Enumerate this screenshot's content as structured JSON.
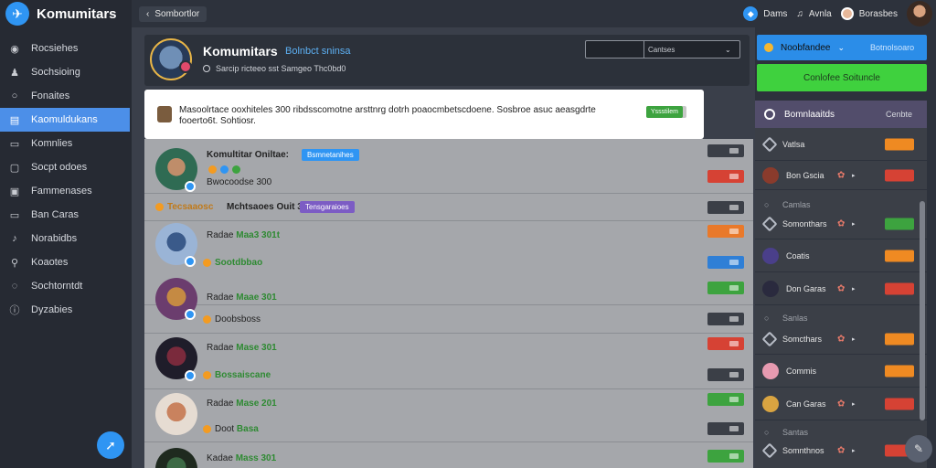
{
  "app": {
    "name": "Komumitars"
  },
  "sidebar": {
    "items": [
      {
        "label": "Rocsiehes",
        "icon": "globe-icon"
      },
      {
        "label": "Sochsioing",
        "icon": "users-icon"
      },
      {
        "label": "Fonaites",
        "icon": "search-icon"
      },
      {
        "label": "Kaomuldukans",
        "icon": "list-icon",
        "active": true
      },
      {
        "label": "Komnlies",
        "icon": "folder-icon"
      },
      {
        "label": "Socpt odoes",
        "icon": "clipboard-icon"
      },
      {
        "label": "Fammenases",
        "icon": "calendar-icon"
      },
      {
        "label": "Ban Caras",
        "icon": "card-icon"
      },
      {
        "label": "Norabidbs",
        "icon": "bell-icon"
      },
      {
        "label": "Koaotes",
        "icon": "share-icon"
      },
      {
        "label": "Sochtorntdt",
        "icon": "chat-icon"
      },
      {
        "label": "Dyzabies",
        "icon": "info-icon"
      }
    ]
  },
  "topbar": {
    "back_label": "Sombortlor",
    "items": [
      "Dams",
      "Avnla",
      "Borasbes"
    ]
  },
  "header": {
    "title": "Komumitars",
    "subtitle": "Bolnbct sninsa",
    "meta": "Sarcip ricteeo sst Samgeo Thc0bd0",
    "select_value": "Cantses"
  },
  "notice": {
    "text": "Masoolrtace ooxhiteles 300 ribdsscomotne arsttnrg dotrh poaocmbetscdoene. Sosbroe asuc aeasgdrte fooerto6t. Sohtiosr.",
    "button": "Yssstilem"
  },
  "feed": {
    "rows": [
      {
        "name": "Komultitar Oniltae:",
        "tag": "Bsmnetanihes",
        "tag_color": "#2f95f3",
        "line2": "Bwocoodse 300",
        "actions": [
          "dark",
          "red"
        ]
      },
      {
        "name": "Mchtsaoes Ouit 3c",
        "tag": "Tensgaraioes",
        "tag_color": "#7c5cc4",
        "prefix": "Tecsaaosc",
        "actions": [
          "dark",
          "orange"
        ]
      },
      {
        "name": "Radae",
        "green": "Maa3 301t",
        "line2": "Sootdbbao",
        "line2_green": true,
        "actions": [
          "blue",
          "green"
        ]
      },
      {
        "name": "Radae",
        "green": "Maae 301",
        "line2": "Doobsboss",
        "actions": [
          "dark",
          "red"
        ]
      },
      {
        "name": "Radae",
        "green": "Mase 301",
        "line2": "Bossaiscane",
        "line2_green": true,
        "actions": [
          "dark",
          "green"
        ]
      },
      {
        "name": "Radae",
        "green": "Mase 201",
        "line2": "Doot",
        "line2_green_word": "Basa",
        "actions": [
          "dark",
          "green"
        ]
      },
      {
        "name": "Kadae",
        "green": "Mass 301",
        "actions": [
          "dark",
          "green"
        ]
      }
    ]
  },
  "right_panel": {
    "dropdown_label": "Noobfandee",
    "dropdown_value": "Botnolsoaro",
    "green_button": "Conlofee Soituncle",
    "list_title": "Bomnlaaitds",
    "list_tab": "Cenbte",
    "items": [
      {
        "label": "Vatlsa",
        "btn": "orange"
      },
      {
        "label": "Bon Gscia",
        "btn": "red",
        "flower": true
      },
      {
        "label": "Camlas",
        "sub": true
      },
      {
        "label": "Somonthars",
        "btn": "green",
        "flower": true
      },
      {
        "label": "Coatis",
        "btn": "orange"
      },
      {
        "label": "Don Garas",
        "btn": "red",
        "flower": true
      },
      {
        "label": "Sanlas",
        "sub": true
      },
      {
        "label": "Somcthars",
        "btn": "orange",
        "flower": true
      },
      {
        "label": "Commis",
        "btn": "orange"
      },
      {
        "label": "Can Garas",
        "btn": "red",
        "flower": true
      },
      {
        "label": "Santas",
        "sub": true
      },
      {
        "label": "Somnthnos",
        "btn": "red",
        "flower": true
      }
    ]
  }
}
